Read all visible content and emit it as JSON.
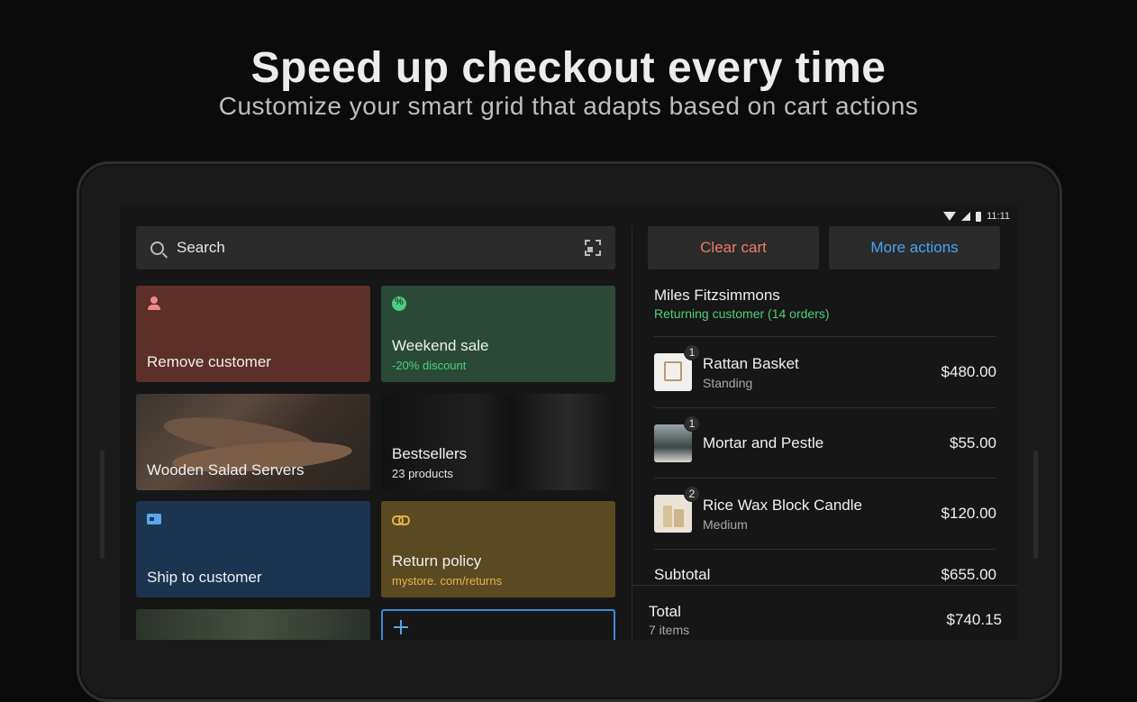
{
  "headline": {
    "title": "Speed up checkout every time",
    "subtitle": "Customize your smart grid that adapts based on cart actions"
  },
  "status_bar": {
    "time": "11:11"
  },
  "search": {
    "placeholder": "Search"
  },
  "tiles": {
    "remove_customer": {
      "label": "Remove customer"
    },
    "weekend_sale": {
      "label": "Weekend sale",
      "sub": "-20% discount"
    },
    "wooden_salad_servers": {
      "label": "Wooden Salad Servers"
    },
    "bestsellers": {
      "label": "Bestsellers",
      "sub": "23 products"
    },
    "ship_to_customer": {
      "label": "Ship to customer"
    },
    "return_policy": {
      "label": "Return policy",
      "sub": "mystore. com/returns"
    }
  },
  "cart": {
    "clear_label": "Clear cart",
    "more_label": "More actions",
    "customer": {
      "name": "Miles Fitzsimmons",
      "status": "Returning customer (14 orders)"
    },
    "items": [
      {
        "qty": "1",
        "name": "Rattan Basket",
        "variant": "Standing",
        "price": "$480.00"
      },
      {
        "qty": "1",
        "name": "Mortar and Pestle",
        "variant": "",
        "price": "$55.00"
      },
      {
        "qty": "2",
        "name": "Rice Wax Block Candle",
        "variant": "Medium",
        "price": "$120.00"
      }
    ],
    "subtotal_label": "Subtotal",
    "subtotal": "$655.00",
    "total_label": "Total",
    "total_items": "7 items",
    "total": "$740.15"
  },
  "colors": {
    "accent_blue": "#4aa3f0",
    "danger_red": "#f07a6c",
    "success_green": "#4ccf7e"
  }
}
